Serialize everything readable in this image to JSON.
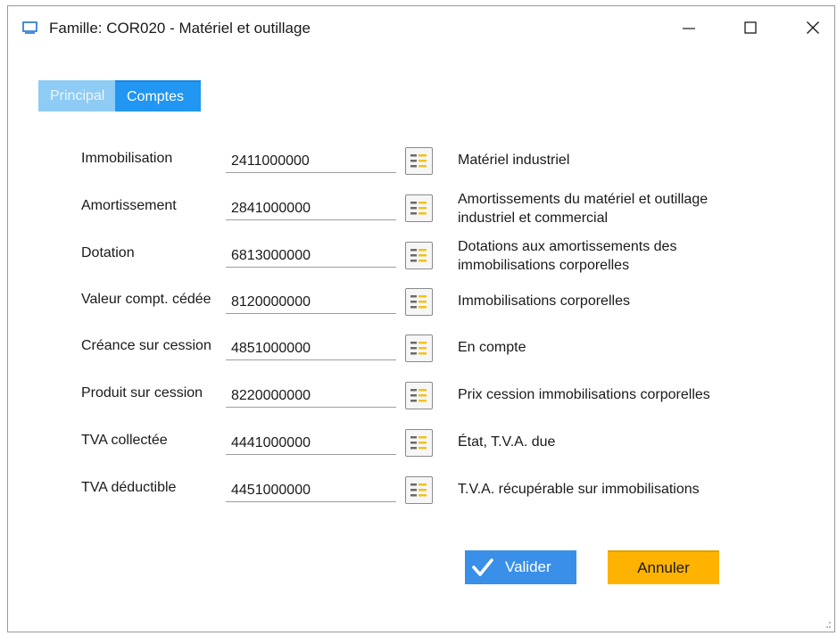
{
  "window": {
    "title": "Famille: COR020 - Matériel et outillage",
    "icon": "window-icon"
  },
  "tabs": [
    {
      "label": "Principal",
      "active": false
    },
    {
      "label": "Comptes",
      "active": true
    }
  ],
  "rows": [
    {
      "label": "Immobilisation",
      "value": "2411000000",
      "description": "Matériel industriel"
    },
    {
      "label": "Amortissement",
      "value": "2841000000",
      "description": "Amortissements du matériel et outillage industriel et commercial"
    },
    {
      "label": "Dotation",
      "value": "6813000000",
      "description": "Dotations aux amortissements des immobilisations corporelles"
    },
    {
      "label": "Valeur compt. cédée",
      "value": "8120000000",
      "description": "Immobilisations corporelles"
    },
    {
      "label": "Créance sur cession",
      "value": "4851000000",
      "description": "En compte"
    },
    {
      "label": "Produit sur cession",
      "value": "8220000000",
      "description": "Prix cession immobilisations corporelles"
    },
    {
      "label": "TVA collectée",
      "value": "4441000000",
      "description": "État, T.V.A. due"
    },
    {
      "label": "TVA déductible",
      "value": "4451000000",
      "description": "T.V.A. récupérable sur immobilisations"
    }
  ],
  "buttons": {
    "validate_label": "Valider",
    "cancel_label": "Annuler"
  },
  "colors": {
    "tab_active": "#2196f3",
    "tab_inactive": "#8ecbf5",
    "validate": "#3a8fe8",
    "cancel": "#ffb300"
  }
}
